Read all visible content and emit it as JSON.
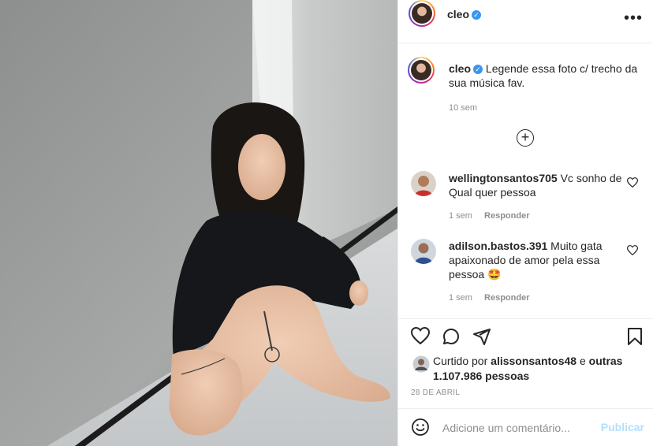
{
  "post": {
    "username": "cleo",
    "verified_mark": "✓",
    "more_icon": "•••",
    "caption": "Legende essa foto c/ trecho da sua música fav.",
    "caption_time": "10 sem",
    "load_more_icon": "+"
  },
  "comments": [
    {
      "username": "wellingtonsantos705",
      "text": "Vc sonho de Qual quer pessoa",
      "time": "1 sem",
      "reply_label": "Responder"
    },
    {
      "username": "adilson.bastos.391",
      "text": "Muito gata apaixonado de amor pela essa pessoa",
      "emoji": "🤩",
      "time": "1 sem",
      "reply_label": "Responder"
    }
  ],
  "likes": {
    "prefix": "Curtido por",
    "first_liker": "alissonsantos48",
    "connector": "e",
    "others": "outras 1.107.986 pessoas"
  },
  "date": "28 DE ABRIL",
  "comment_box": {
    "placeholder": "Adicione um comentário...",
    "publish_label": "Publicar"
  },
  "colors": {
    "verified": "#3897f0",
    "publish_disabled": "#b2dffc",
    "muted_text": "#8e8e8e"
  }
}
